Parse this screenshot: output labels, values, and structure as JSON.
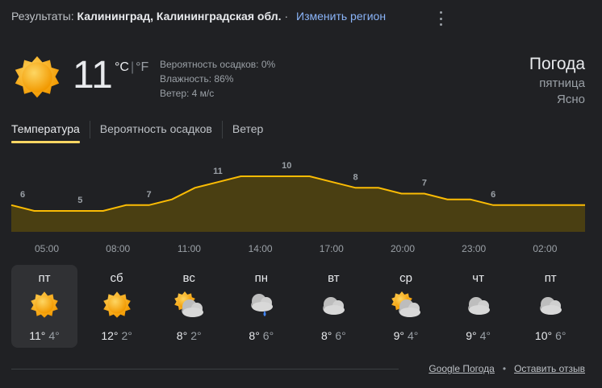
{
  "header": {
    "prefix": "Результаты:",
    "location": "Калининград, Калининградская обл.",
    "change_region": "Изменить регион"
  },
  "current": {
    "temp": "11",
    "unit_c": "°C",
    "unit_sep": "|",
    "unit_f": "°F",
    "precip": "Вероятность осадков: 0%",
    "humidity": "Влажность: 86%",
    "wind": "Ветер: 4 м/с",
    "icon": "sun-icon"
  },
  "summary": {
    "title": "Погода",
    "day": "пятница",
    "condition": "Ясно"
  },
  "tabs": [
    "Температура",
    "Вероятность осадков",
    "Ветер"
  ],
  "colors": {
    "accent": "#fdd663",
    "chart_fill": "#4a3f12",
    "chart_line": "#fbbc04",
    "link": "#8ab4f8",
    "background": "#202124"
  },
  "chart_data": {
    "type": "area",
    "x": [
      "02:00",
      "03:00",
      "04:00",
      "05:00",
      "06:00",
      "07:00",
      "08:00",
      "09:00",
      "10:00",
      "11:00",
      "12:00",
      "13:00",
      "14:00",
      "15:00",
      "16:00",
      "17:00",
      "18:00",
      "19:00",
      "20:00",
      "21:00",
      "22:00",
      "23:00",
      "00:00",
      "01:00",
      "02:00",
      "03:00"
    ],
    "values": [
      6,
      5,
      5,
      5,
      5,
      6,
      6,
      7,
      9,
      10,
      11,
      11,
      11,
      11,
      10,
      9,
      9,
      8,
      8,
      7,
      7,
      6,
      6,
      6,
      6,
      6
    ],
    "labels": [
      6,
      5,
      7,
      11,
      10,
      8,
      7,
      6
    ],
    "ticks": [
      "05:00",
      "08:00",
      "11:00",
      "14:00",
      "17:00",
      "20:00",
      "23:00",
      "02:00"
    ],
    "ylim": [
      0,
      13
    ]
  },
  "days": [
    {
      "name": "пт",
      "hi": "11°",
      "lo": "4°",
      "icon": "sun-icon"
    },
    {
      "name": "сб",
      "hi": "12°",
      "lo": "2°",
      "icon": "sun-icon"
    },
    {
      "name": "вс",
      "hi": "8°",
      "lo": "2°",
      "icon": "partly-cloudy-icon"
    },
    {
      "name": "пн",
      "hi": "8°",
      "lo": "6°",
      "icon": "rain-icon"
    },
    {
      "name": "вт",
      "hi": "8°",
      "lo": "6°",
      "icon": "cloud-icon"
    },
    {
      "name": "ср",
      "hi": "9°",
      "lo": "4°",
      "icon": "partly-cloudy-icon"
    },
    {
      "name": "чт",
      "hi": "9°",
      "lo": "4°",
      "icon": "cloud-icon"
    },
    {
      "name": "пт",
      "hi": "10°",
      "lo": "6°",
      "icon": "cloud-icon"
    }
  ],
  "footer": {
    "source": "Google Погода",
    "separator": "•",
    "feedback": "Оставить отзыв"
  }
}
